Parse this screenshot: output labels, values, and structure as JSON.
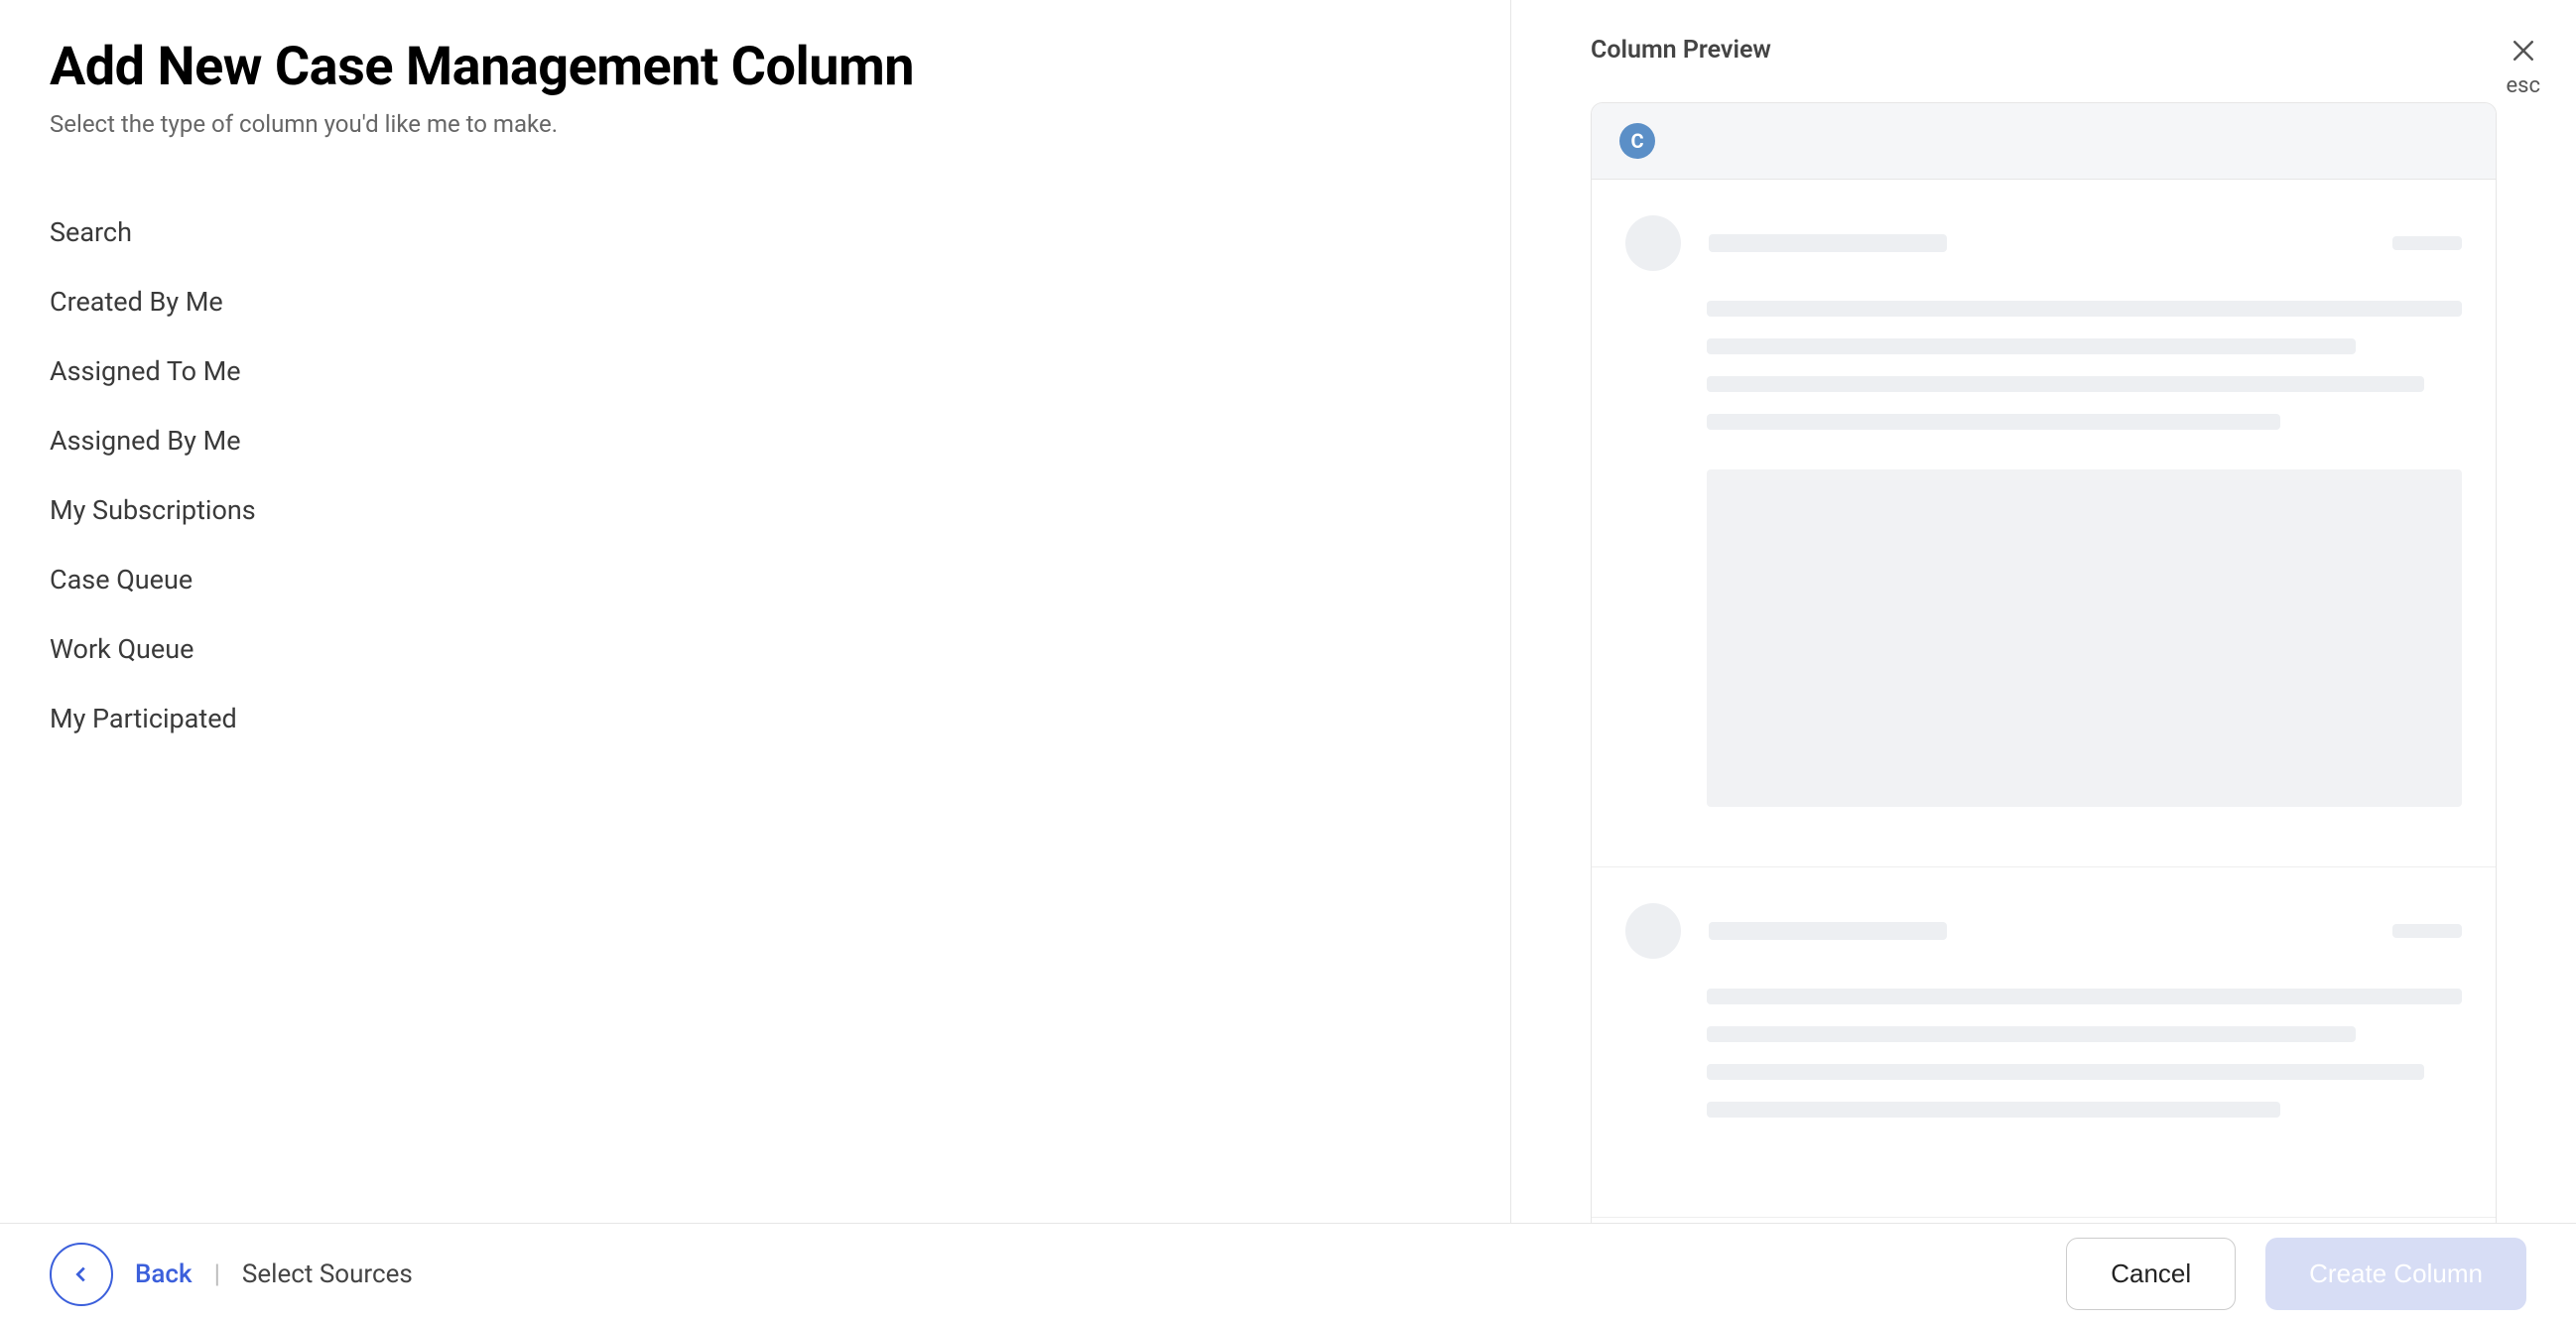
{
  "header": {
    "title": "Add New Case Management Column",
    "subtitle": "Select the type of column you'd like me to make."
  },
  "column_types": [
    "Search",
    "Created By Me",
    "Assigned To Me",
    "Assigned By Me",
    "My Subscriptions",
    "Case Queue",
    "Work Queue",
    "My Participated"
  ],
  "preview": {
    "title": "Column Preview",
    "brand_letter": "C"
  },
  "close": {
    "label": "esc"
  },
  "footer": {
    "back_label": "Back",
    "crumb": "Select Sources",
    "cancel_label": "Cancel",
    "create_label": "Create Column"
  },
  "colors": {
    "accent": "#3b5fdb",
    "brand_circle": "#5b8fc7",
    "disabled_button_bg": "#d7ddf5"
  }
}
